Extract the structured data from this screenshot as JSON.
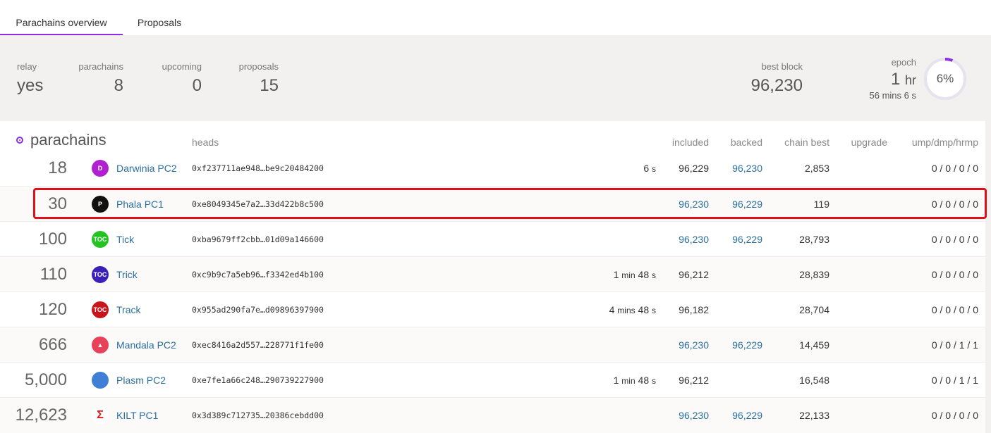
{
  "tabs": [
    {
      "label": "Parachains overview",
      "active": true
    },
    {
      "label": "Proposals",
      "active": false
    }
  ],
  "summary": {
    "relay": {
      "label": "relay",
      "value": "yes"
    },
    "parachains": {
      "label": "parachains",
      "value": "8"
    },
    "upcoming": {
      "label": "upcoming",
      "value": "0"
    },
    "proposals": {
      "label": "proposals",
      "value": "15"
    },
    "best_block": {
      "label": "best block",
      "value": "96,230"
    },
    "epoch": {
      "label": "epoch",
      "value": "1",
      "unit": "hr",
      "sub_value": "56",
      "sub_unit": "mins",
      "sub_value2": "6",
      "sub_unit2": "s",
      "percent_label": "6%",
      "percent": 0.06
    }
  },
  "table": {
    "title": "parachains",
    "headers": {
      "heads": "heads",
      "included": "included",
      "backed": "backed",
      "chain_best": "chain best",
      "upgrade": "upgrade",
      "ump": "ump/dmp/hrmp"
    },
    "rows": [
      {
        "id": "18",
        "name": "Darwinia PC2",
        "head": "0xf237711ae948…be9c20484200",
        "time_val": "6",
        "time_unit": "s",
        "included": "96,229",
        "backed": "96,230",
        "chain_best": "2,853",
        "ump": "0 / 0 / 0 / 0",
        "icon": "darwinia-icon",
        "icon_color": "#b01fd0",
        "icon_text": "D"
      },
      {
        "id": "30",
        "name": "Phala PC1",
        "head": "0xe8049345e7a2…33d422b8c500",
        "time_val": "",
        "time_unit": "",
        "included": "96,230",
        "backed": "96,229",
        "chain_best": "119",
        "ump": "0 / 0 / 0 / 0",
        "icon": "phala-icon",
        "icon_color": "#111111",
        "icon_text": "P"
      },
      {
        "id": "100",
        "name": "Tick",
        "head": "0xba9679ff2cbb…01d09a146600",
        "time_val": "",
        "time_unit": "",
        "included": "96,230",
        "backed": "96,229",
        "chain_best": "28,793",
        "ump": "0 / 0 / 0 / 0",
        "icon": "tick-icon",
        "icon_color": "#22c322",
        "icon_text": "TOC"
      },
      {
        "id": "110",
        "name": "Trick",
        "head": "0xc9b9c7a5eb96…f3342ed4b100",
        "time_val": "1",
        "time_unit": "min",
        "time_val2": "48",
        "time_unit2": "s",
        "included": "96,212",
        "backed": "",
        "chain_best": "28,839",
        "ump": "0 / 0 / 0 / 0",
        "icon": "trick-icon",
        "icon_color": "#3a1fb8",
        "icon_text": "TOC"
      },
      {
        "id": "120",
        "name": "Track",
        "head": "0x955ad290fa7e…d09896397900",
        "time_val": "4",
        "time_unit": "mins",
        "time_val2": "48",
        "time_unit2": "s",
        "included": "96,182",
        "backed": "",
        "chain_best": "28,704",
        "ump": "0 / 0 / 0 / 0",
        "icon": "track-icon",
        "icon_color": "#c8141c",
        "icon_text": "TOC"
      },
      {
        "id": "666",
        "name": "Mandala PC2",
        "head": "0xec8416a2d557…228771f1fe00",
        "time_val": "",
        "time_unit": "",
        "included": "96,230",
        "backed": "96,229",
        "chain_best": "14,459",
        "ump": "0 / 0 / 1 / 1",
        "icon": "mandala-icon",
        "icon_color": "#e8415a",
        "icon_text": "▲"
      },
      {
        "id": "5,000",
        "name": "Plasm PC2",
        "head": "0xe7fe1a66c248…290739227900",
        "time_val": "1",
        "time_unit": "min",
        "time_val2": "48",
        "time_unit2": "s",
        "included": "96,212",
        "backed": "",
        "chain_best": "16,548",
        "ump": "0 / 0 / 1 / 1",
        "icon": "plasm-icon",
        "icon_color": "#3f7fd6",
        "icon_text": ""
      },
      {
        "id": "12,623",
        "name": "KILT PC1",
        "head": "0x3d389c712735…20386cebdd00",
        "time_val": "",
        "time_unit": "",
        "included": "96,230",
        "backed": "96,229",
        "chain_best": "22,133",
        "ump": "0 / 0 / 0 / 0",
        "icon": "kilt-icon",
        "icon_color": "#ffffff",
        "icon_text": "Σ"
      }
    ]
  },
  "colors": {
    "accent": "#8d2ee0",
    "link": "#2a6f9e",
    "highlight": "#e0101a"
  }
}
